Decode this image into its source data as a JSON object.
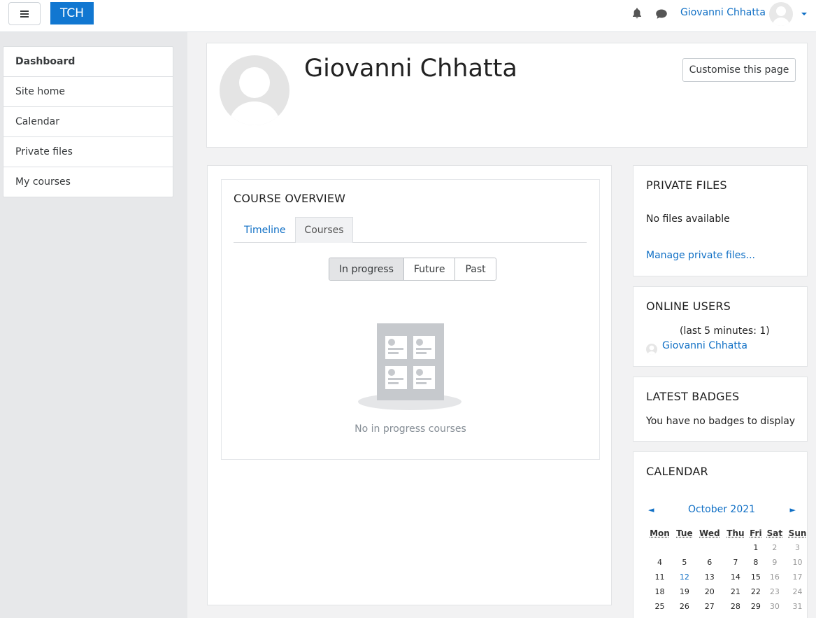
{
  "navbar": {
    "brand": "TCH",
    "user_name": "Giovanni Chhatta"
  },
  "nav": {
    "items": [
      {
        "label": "Dashboard"
      },
      {
        "label": "Site home"
      },
      {
        "label": "Calendar"
      },
      {
        "label": "Private files"
      },
      {
        "label": "My courses"
      }
    ]
  },
  "header": {
    "title": "Giovanni Chhatta",
    "customise_button": "Customise this page"
  },
  "course_overview": {
    "title": "COURSE OVERVIEW",
    "tabs": [
      {
        "label": "Timeline"
      },
      {
        "label": "Courses"
      }
    ],
    "filters": [
      {
        "label": "In progress"
      },
      {
        "label": "Future"
      },
      {
        "label": "Past"
      }
    ],
    "empty_text": "No in progress courses"
  },
  "private_files": {
    "title": "PRIVATE FILES",
    "empty_text": "No files available",
    "manage_link": "Manage private files..."
  },
  "online_users": {
    "title": "ONLINE USERS",
    "period": "(last 5 minutes: 1)",
    "user": "Giovanni Chhatta"
  },
  "latest_badges": {
    "title": "LATEST BADGES",
    "text": "You have no badges to display"
  },
  "calendar": {
    "title": "CALENDAR",
    "prev": "◄",
    "next": "►",
    "month": "October 2021",
    "days": [
      "Mon",
      "Tue",
      "Wed",
      "Thu",
      "Fri",
      "Sat",
      "Sun"
    ],
    "weeks": [
      [
        "",
        "",
        "",
        "",
        "1",
        "2",
        "3"
      ],
      [
        "4",
        "5",
        "6",
        "7",
        "8",
        "9",
        "10"
      ],
      [
        "11",
        "12",
        "13",
        "14",
        "15",
        "16",
        "17"
      ],
      [
        "18",
        "19",
        "20",
        "21",
        "22",
        "23",
        "24"
      ],
      [
        "25",
        "26",
        "27",
        "28",
        "29",
        "30",
        "31"
      ]
    ],
    "today": "12"
  }
}
